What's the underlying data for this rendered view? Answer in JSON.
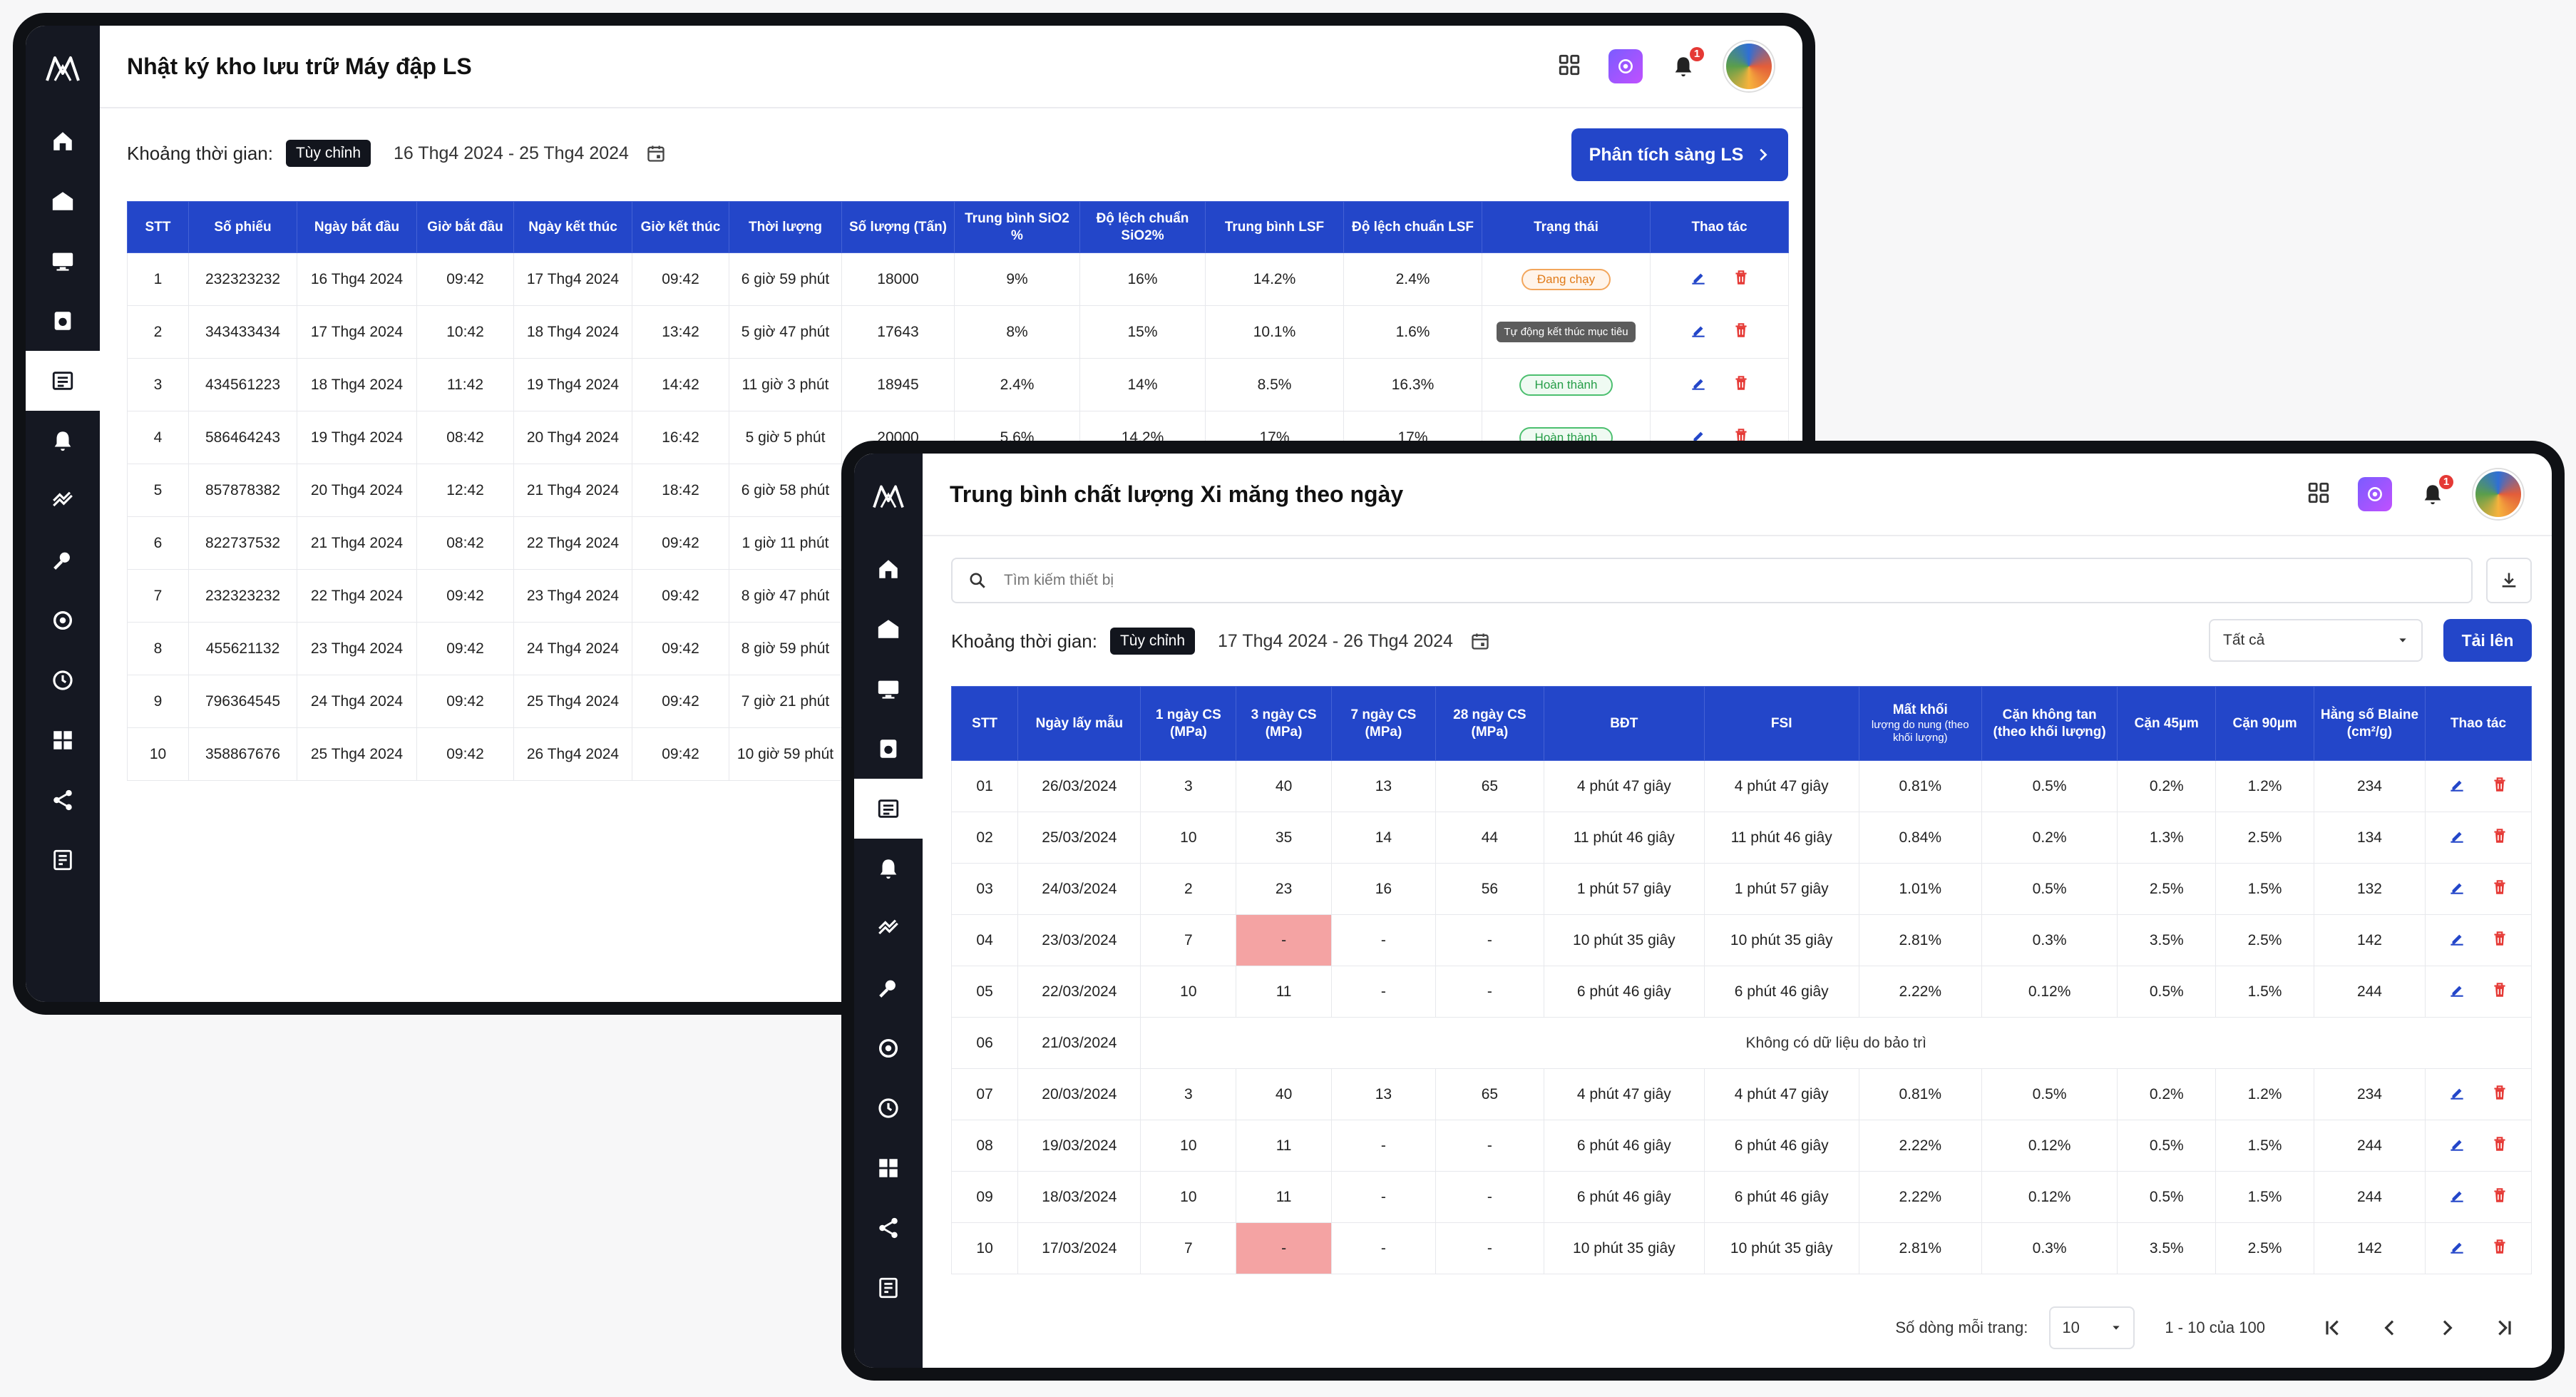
{
  "colors": {
    "accent": "#2346c9",
    "sidebar": "#151822",
    "running": "#e07b1a",
    "done": "#259d47",
    "error_cell": "#f4a3a3",
    "delete": "#e53935"
  },
  "panel1": {
    "title": "Nhật ký kho lưu trữ Máy đập LS",
    "notification_count": "1",
    "filter": {
      "label": "Khoảng thời gian:",
      "chip": "Tùy chỉnh",
      "range": "16 Thg4 2024 - 25 Thg4 2024"
    },
    "analyze_button": "Phân tích sàng LS",
    "columns": [
      "STT",
      "Số phiếu",
      "Ngày bắt đầu",
      "Giờ bắt đầu",
      "Ngày kết thúc",
      "Giờ kết thúc",
      "Thời lượng",
      "Số lượng (Tấn)",
      "Trung bình SiO2 %",
      "Độ lệch chuẩn SiO2%",
      "Trung bình LSF",
      "Độ lệch chuẩn LSF",
      "Trạng thái",
      "Thao tác"
    ],
    "rows": [
      {
        "stt": "1",
        "so_phieu": "232323232",
        "ngay_bd": "16 Thg4 2024",
        "gio_bd": "09:42",
        "ngay_kt": "17 Thg4 2024",
        "gio_kt": "09:42",
        "thoi_luong": "6 giờ 59 phút",
        "so_luong": "18000",
        "tb_sio2": "9%",
        "dlc_sio2": "16%",
        "tb_lsf": "14.2%",
        "dlc_lsf": "2.4%",
        "trang_thai": "Đang chạy"
      },
      {
        "stt": "2",
        "so_phieu": "343433434",
        "ngay_bd": "17 Thg4 2024",
        "gio_bd": "10:42",
        "ngay_kt": "18 Thg4 2024",
        "gio_kt": "13:42",
        "thoi_luong": "5 giờ 47 phút",
        "so_luong": "17643",
        "tb_sio2": "8%",
        "dlc_sio2": "15%",
        "tb_lsf": "10.1%",
        "dlc_lsf": "1.6%",
        "trang_thai": "Tự động kết thúc mục tiêu"
      },
      {
        "stt": "3",
        "so_phieu": "434561223",
        "ngay_bd": "18 Thg4 2024",
        "gio_bd": "11:42",
        "ngay_kt": "19 Thg4 2024",
        "gio_kt": "14:42",
        "thoi_luong": "11 giờ 3 phút",
        "so_luong": "18945",
        "tb_sio2": "2.4%",
        "dlc_sio2": "14%",
        "tb_lsf": "8.5%",
        "dlc_lsf": "16.3%",
        "trang_thai": "Hoàn thành"
      },
      {
        "stt": "4",
        "so_phieu": "586464243",
        "ngay_bd": "19 Thg4 2024",
        "gio_bd": "08:42",
        "ngay_kt": "20 Thg4 2024",
        "gio_kt": "16:42",
        "thoi_luong": "5 giờ 5 phút",
        "so_luong": "20000",
        "tb_sio2": "5.6%",
        "dlc_sio2": "14.2%",
        "tb_lsf": "17%",
        "dlc_lsf": "17%",
        "trang_thai": "Hoàn thành"
      },
      {
        "stt": "5",
        "so_phieu": "857878382",
        "ngay_bd": "20 Thg4 2024",
        "gio_bd": "12:42",
        "ngay_kt": "21 Thg4 2024",
        "gio_kt": "18:42",
        "thoi_luong": "6 giờ 58 phút"
      },
      {
        "stt": "6",
        "so_phieu": "822737532",
        "ngay_bd": "21 Thg4 2024",
        "gio_bd": "08:42",
        "ngay_kt": "22 Thg4 2024",
        "gio_kt": "09:42",
        "thoi_luong": "1 giờ 11 phút"
      },
      {
        "stt": "7",
        "so_phieu": "232323232",
        "ngay_bd": "22 Thg4 2024",
        "gio_bd": "09:42",
        "ngay_kt": "23 Thg4 2024",
        "gio_kt": "09:42",
        "thoi_luong": "8 giờ 47 phút"
      },
      {
        "stt": "8",
        "so_phieu": "455621132",
        "ngay_bd": "23 Thg4 2024",
        "gio_bd": "09:42",
        "ngay_kt": "24 Thg4 2024",
        "gio_kt": "09:42",
        "thoi_luong": "8 giờ 59 phút"
      },
      {
        "stt": "9",
        "so_phieu": "796364545",
        "ngay_bd": "24 Thg4 2024",
        "gio_bd": "09:42",
        "ngay_kt": "25 Thg4 2024",
        "gio_kt": "09:42",
        "thoi_luong": "7 giờ 21 phút"
      },
      {
        "stt": "10",
        "so_phieu": "358867676",
        "ngay_bd": "25 Thg4 2024",
        "gio_bd": "09:42",
        "ngay_kt": "26 Thg4 2024",
        "gio_kt": "09:42",
        "thoi_luong": "10 giờ 59 phút"
      }
    ]
  },
  "panel2": {
    "title": "Trung bình chất lượng Xi măng theo ngày",
    "notification_count": "1",
    "search_placeholder": "Tìm kiếm thiết bị",
    "filter": {
      "label": "Khoảng thời gian:",
      "chip": "Tùy chỉnh",
      "range": "17 Thg4 2024 - 26 Thg4 2024"
    },
    "select_value": "Tất cả",
    "upload_button": "Tải lên",
    "columns": [
      "STT",
      "Ngày lấy mẫu",
      "1 ngày CS (MPa)",
      "3 ngày CS (MPa)",
      "7 ngày CS (MPa)",
      "28 ngày CS (MPa)",
      "BĐT",
      "FSI",
      "Mất khối",
      "lượng do nung (theo khối lượng)",
      "Cặn không tan (theo khối lượng)",
      "Cặn 45µm",
      "Cặn 90µm",
      "Hằng số Blaine (cm²/g)",
      "Thao tác"
    ],
    "rows": [
      {
        "stt": "01",
        "ngay": "26/03/2024",
        "cs1": "3",
        "cs3": "40",
        "cs7": "13",
        "cs28": "65",
        "bdt": "4 phút 47 giây",
        "fsi": "4 phút 47 giây",
        "mkn": "0.81%",
        "ckt": "0.5%",
        "c45": "0.2%",
        "c90": "1.2%",
        "blaine": "234",
        "red": false
      },
      {
        "stt": "02",
        "ngay": "25/03/2024",
        "cs1": "10",
        "cs3": "35",
        "cs7": "14",
        "cs28": "44",
        "bdt": "11 phút 46 giây",
        "fsi": "11 phút 46 giây",
        "mkn": "0.84%",
        "ckt": "0.2%",
        "c45": "1.3%",
        "c90": "2.5%",
        "blaine": "134",
        "red": false
      },
      {
        "stt": "03",
        "ngay": "24/03/2024",
        "cs1": "2",
        "cs3": "23",
        "cs7": "16",
        "cs28": "56",
        "bdt": "1 phút 57 giây",
        "fsi": "1 phút 57 giây",
        "mkn": "1.01%",
        "ckt": "0.5%",
        "c45": "2.5%",
        "c90": "1.5%",
        "blaine": "132",
        "red": false
      },
      {
        "stt": "04",
        "ngay": "23/03/2024",
        "cs1": "7",
        "cs3": "-",
        "cs7": "-",
        "cs28": "-",
        "bdt": "10 phút 35 giây",
        "fsi": "10 phút 35 giây",
        "mkn": "2.81%",
        "ckt": "0.3%",
        "c45": "3.5%",
        "c90": "2.5%",
        "blaine": "142",
        "red": true
      },
      {
        "stt": "05",
        "ngay": "22/03/2024",
        "cs1": "10",
        "cs3": "11",
        "cs7": "-",
        "cs28": "-",
        "bdt": "6 phút 46 giây",
        "fsi": "6 phút 46 giây",
        "mkn": "2.22%",
        "ckt": "0.12%",
        "c45": "0.5%",
        "c90": "1.5%",
        "blaine": "244",
        "red": false
      },
      {
        "stt": "06",
        "ngay": "21/03/2024",
        "note": "Không có dữ liệu do bảo trì"
      },
      {
        "stt": "07",
        "ngay": "20/03/2024",
        "cs1": "3",
        "cs3": "40",
        "cs7": "13",
        "cs28": "65",
        "bdt": "4 phút 47 giây",
        "fsi": "4 phút 47 giây",
        "mkn": "0.81%",
        "ckt": "0.5%",
        "c45": "0.2%",
        "c90": "1.2%",
        "blaine": "234",
        "red": false
      },
      {
        "stt": "08",
        "ngay": "19/03/2024",
        "cs1": "10",
        "cs3": "11",
        "cs7": "-",
        "cs28": "-",
        "bdt": "6 phút 46 giây",
        "fsi": "6 phút 46 giây",
        "mkn": "2.22%",
        "ckt": "0.12%",
        "c45": "0.5%",
        "c90": "1.5%",
        "blaine": "244",
        "red": false
      },
      {
        "stt": "09",
        "ngay": "18/03/2024",
        "cs1": "10",
        "cs3": "11",
        "cs7": "-",
        "cs28": "-",
        "bdt": "6 phút 46 giây",
        "fsi": "6 phút 46 giây",
        "mkn": "2.22%",
        "ckt": "0.12%",
        "c45": "0.5%",
        "c90": "1.5%",
        "blaine": "244",
        "red": false
      },
      {
        "stt": "10",
        "ngay": "17/03/2024",
        "cs1": "7",
        "cs3": "-",
        "cs7": "-",
        "cs28": "-",
        "bdt": "10 phút 35 giây",
        "fsi": "10 phút 35 giây",
        "mkn": "2.81%",
        "ckt": "0.3%",
        "c45": "3.5%",
        "c90": "2.5%",
        "blaine": "142",
        "red": true
      }
    ],
    "pagination": {
      "rows_label": "Số dòng mỗi trang:",
      "rows_value": "10",
      "range": "1 - 10 của 100"
    }
  }
}
